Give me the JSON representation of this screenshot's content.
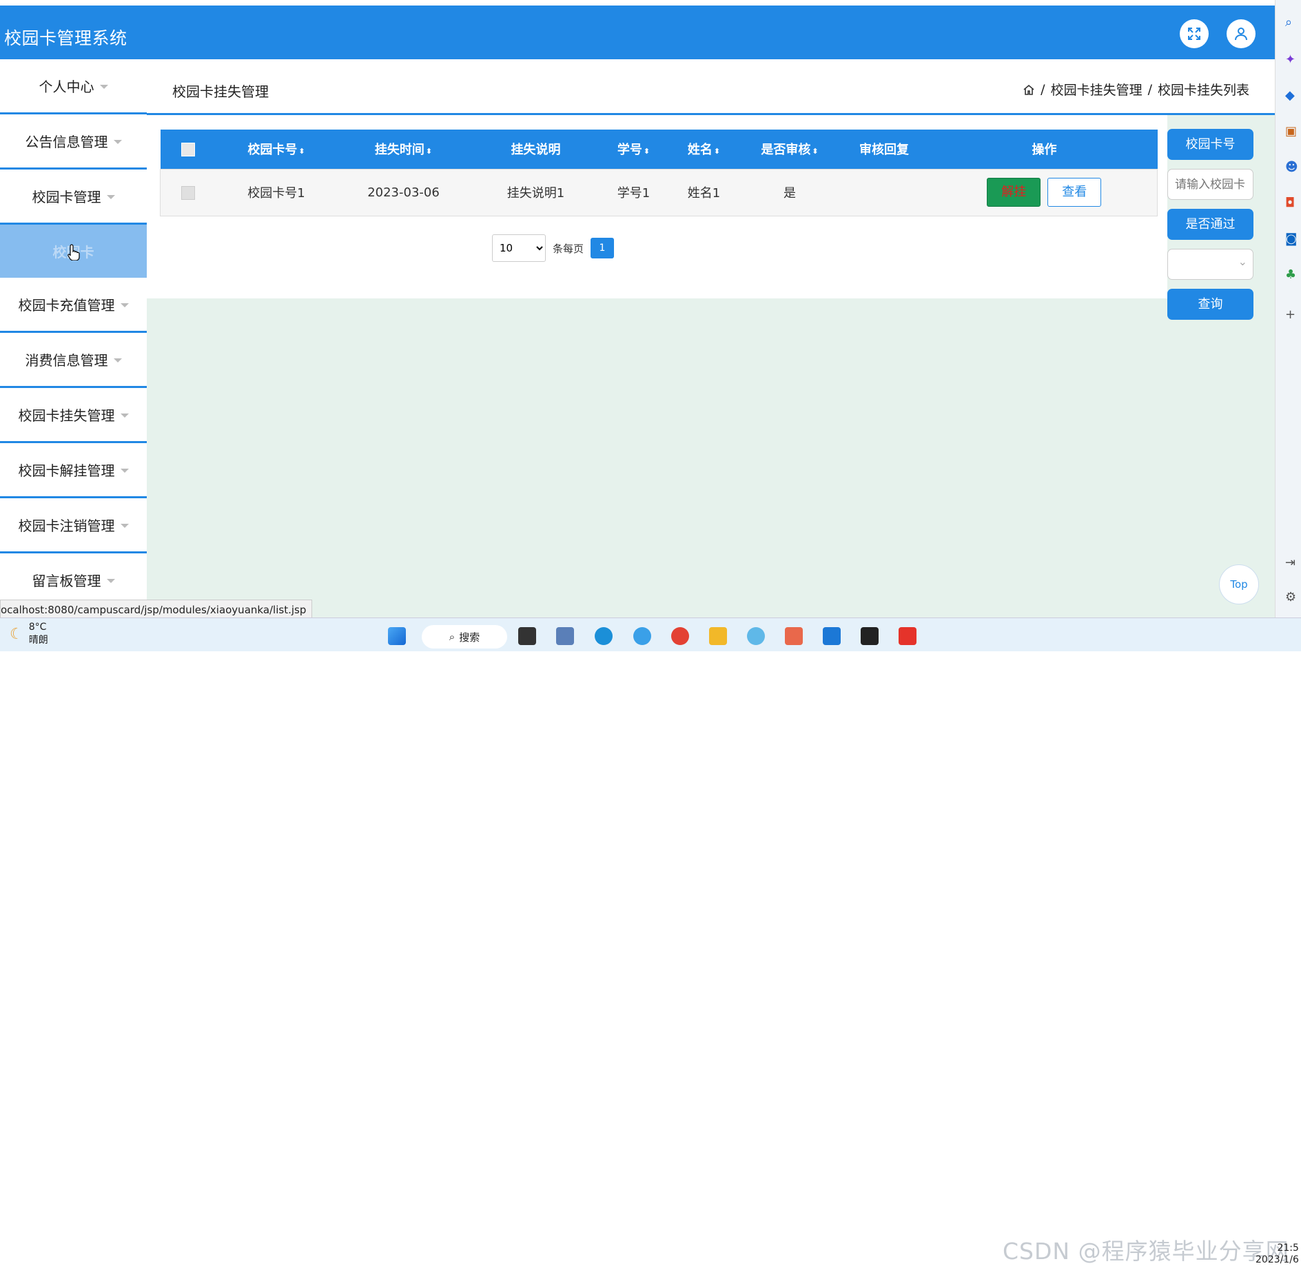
{
  "app": {
    "title": "校园卡管理系统"
  },
  "header": {
    "fullscreen_icon": "expand-icon",
    "user_icon": "user-icon"
  },
  "sidebar": {
    "items": [
      {
        "label": "个人中心"
      },
      {
        "label": "公告信息管理"
      },
      {
        "label": "校园卡管理"
      },
      {
        "label": "校园卡",
        "sub": true
      },
      {
        "label": "校园卡充值管理"
      },
      {
        "label": "消费信息管理"
      },
      {
        "label": "校园卡挂失管理"
      },
      {
        "label": "校园卡解挂管理"
      },
      {
        "label": "校园卡注销管理"
      },
      {
        "label": "留言板管理"
      }
    ]
  },
  "page": {
    "title": "校园卡挂失管理",
    "breadcrumb": [
      "校园卡挂失管理",
      "校园卡挂失列表"
    ]
  },
  "table": {
    "columns": [
      "校园卡号",
      "挂失时间",
      "挂失说明",
      "学号",
      "姓名",
      "是否审核",
      "审核回复",
      "操作"
    ],
    "rows": [
      {
        "card_no": "校园卡号1",
        "time": "2023-03-06",
        "desc": "挂失说明1",
        "student_no": "学号1",
        "name": "姓名1",
        "audited": "是",
        "reply": ""
      }
    ],
    "actions": {
      "unlock": "解挂",
      "view": "查看"
    }
  },
  "pagination": {
    "page_size": "10",
    "per_page_label": "条每页",
    "current_page": "1"
  },
  "search": {
    "card_label": "校园卡号",
    "card_placeholder": "请输入校园卡号",
    "pass_label": "是否通过",
    "query_label": "查询"
  },
  "status_url": "ocalhost:8080/campuscard/jsp/modules/xiaoyuanka/list.jsp",
  "top_button": "Top",
  "taskbar": {
    "weather_temp": "8°C",
    "weather_text": "晴朗",
    "search_label": "搜索",
    "clock_time": "21:5",
    "clock_date": "2023/1/6"
  },
  "watermark": "CSDN @程序猿毕业分享网",
  "colors": {
    "primary": "#2188e4",
    "success": "#1a9a55",
    "bg": "#e6f2ec"
  }
}
